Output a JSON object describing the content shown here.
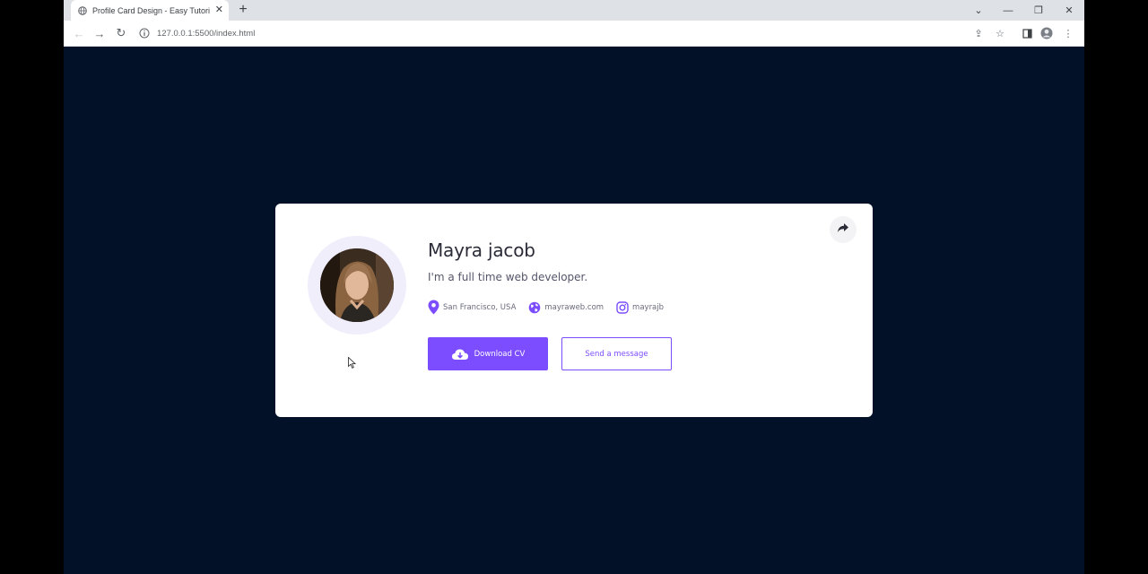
{
  "browser": {
    "tab_title": "Profile Card Design - Easy Tutori",
    "url": "127.0.0.1:5500/index.html"
  },
  "profile": {
    "name": "Mayra jacob",
    "bio": "I'm a full time web developer.",
    "location": "San Francisco, USA",
    "website": "mayraweb.com",
    "instagram": "mayrajb",
    "download_label": "Download CV",
    "message_label": "Send a message"
  },
  "colors": {
    "page_background": "#021127",
    "accent": "#7c4dff",
    "card_background": "#ffffff"
  },
  "icons": {
    "location": "map-pin-icon",
    "website": "globe-icon",
    "instagram": "instagram-icon",
    "download": "cloud-download-icon",
    "share": "share-icon"
  }
}
